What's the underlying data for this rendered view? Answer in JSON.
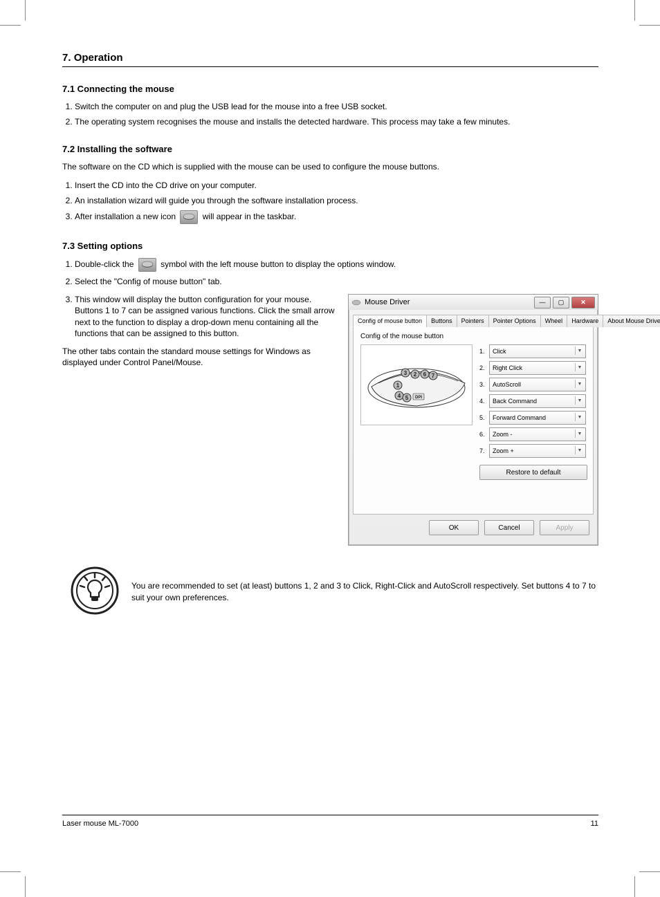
{
  "header": {
    "section_number": "7.",
    "section_title": "Operation"
  },
  "sub1": {
    "title": "7.1 Connecting the mouse",
    "steps": [
      "Switch the computer on and plug the USB lead for the mouse into a free USB socket.",
      "The operating system recognises the mouse and installs the detected hardware. This process may take a few minutes."
    ]
  },
  "sub2": {
    "title": "7.2 Installing the software",
    "p1": "The software on the CD which is supplied with the mouse can be used to configure the mouse buttons.",
    "steps": [
      "Insert the CD into the CD drive on your computer.",
      "An installation wizard will guide you through the software installation process.",
      [
        "After installation a new icon ",
        " will appear in the taskbar."
      ]
    ]
  },
  "sub3": {
    "title": "7.3 Setting options",
    "step1_parts": [
      "Double-click the ",
      " symbol with the left mouse button to display the options window."
    ],
    "step2": "Select the \"Config of mouse button\" tab.",
    "step3": "This window will display the button configuration for your mouse. Buttons 1 to 7 can be assigned various functions. Click the small arrow next to the function to display a drop-down menu containing all the functions that can be assigned to this button.",
    "p_after": "The other tabs contain the standard mouse settings for Windows as displayed under Control Panel/Mouse."
  },
  "mouse_driver": {
    "window_title": "Mouse Driver",
    "tabs": [
      "Config of mouse button",
      "Buttons",
      "Pointers",
      "Pointer Options",
      "Wheel",
      "Hardware",
      "About Mouse Driver"
    ],
    "active_tab": 0,
    "panel_title": "Config of the mouse button",
    "assignments": [
      {
        "n": "1.",
        "value": "Click"
      },
      {
        "n": "2.",
        "value": "Right Click"
      },
      {
        "n": "3.",
        "value": "AutoScroll"
      },
      {
        "n": "4.",
        "value": "Back Command"
      },
      {
        "n": "5.",
        "value": "Forward Command"
      },
      {
        "n": "6.",
        "value": "Zoom -"
      },
      {
        "n": "7.",
        "value": "Zoom +"
      }
    ],
    "restore_label": "Restore to default",
    "ok": "OK",
    "cancel": "Cancel",
    "apply": "Apply"
  },
  "tip": {
    "text": "You are recommended to set (at least) buttons 1, 2 and 3 to Click, Right-Click and AutoScroll respectively. Set buttons 4 to 7 to suit your own preferences."
  },
  "footer": {
    "left": "Laser mouse ML-7000",
    "right": "11"
  }
}
